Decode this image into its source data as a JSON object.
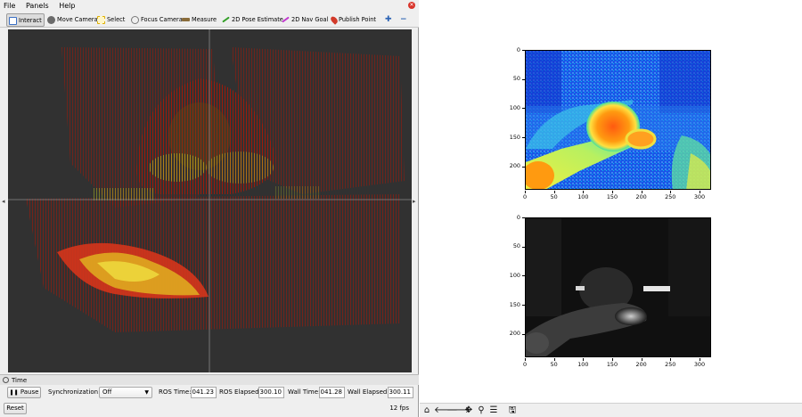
{
  "rviz": {
    "menu": [
      "File",
      "Panels",
      "Help"
    ],
    "tools": [
      {
        "label": "Interact",
        "icon": "interact-icon",
        "color": "#3a6fc4"
      },
      {
        "label": "Move Camera",
        "icon": "move-camera-icon",
        "color": "#6b6b6b"
      },
      {
        "label": "Select",
        "icon": "select-icon",
        "color": "#e0b000"
      },
      {
        "label": "Focus Camera",
        "icon": "focus-camera-icon",
        "color": "#7a7a7a"
      },
      {
        "label": "Measure",
        "icon": "measure-icon",
        "color": "#8a6d3b"
      },
      {
        "label": "2D Pose Estimate",
        "icon": "pose-estimate-icon",
        "color": "#35a02a"
      },
      {
        "label": "2D Nav Goal",
        "icon": "nav-goal-icon",
        "color": "#c23ad0"
      },
      {
        "label": "Publish Point",
        "icon": "publish-point-icon",
        "color": "#d23a2a"
      }
    ],
    "time_panel": {
      "title": "Time",
      "pause_label": "Pause",
      "sync_label": "Synchronization:",
      "sync_value": "Off",
      "ros_time_label": "ROS Time:",
      "ros_time_value": "3041.23",
      "ros_elapsed_label": "ROS Elapsed:",
      "ros_elapsed_value": "1300.10",
      "wall_time_label": "Wall Time:",
      "wall_time_value": "3041.28",
      "wall_elapsed_label": "Wall Elapsed:",
      "wall_elapsed_value": "1300.11",
      "reset_label": "Reset",
      "fps": "12 fps"
    }
  },
  "plots": [
    {
      "name": "depth-colormap",
      "yticks": [
        "0",
        "50",
        "100",
        "150",
        "200"
      ],
      "xticks": [
        "0",
        "50",
        "100",
        "150",
        "200",
        "250",
        "300"
      ]
    },
    {
      "name": "grayscale-image",
      "yticks": [
        "0",
        "50",
        "100",
        "150",
        "200"
      ],
      "xticks": [
        "0",
        "50",
        "100",
        "150",
        "200",
        "250",
        "300"
      ]
    }
  ],
  "mpl_toolbar": [
    "home-icon",
    "back-icon",
    "forward-icon",
    "pan-icon",
    "zoom-icon",
    "configure-subplots-icon",
    "save-icon"
  ]
}
